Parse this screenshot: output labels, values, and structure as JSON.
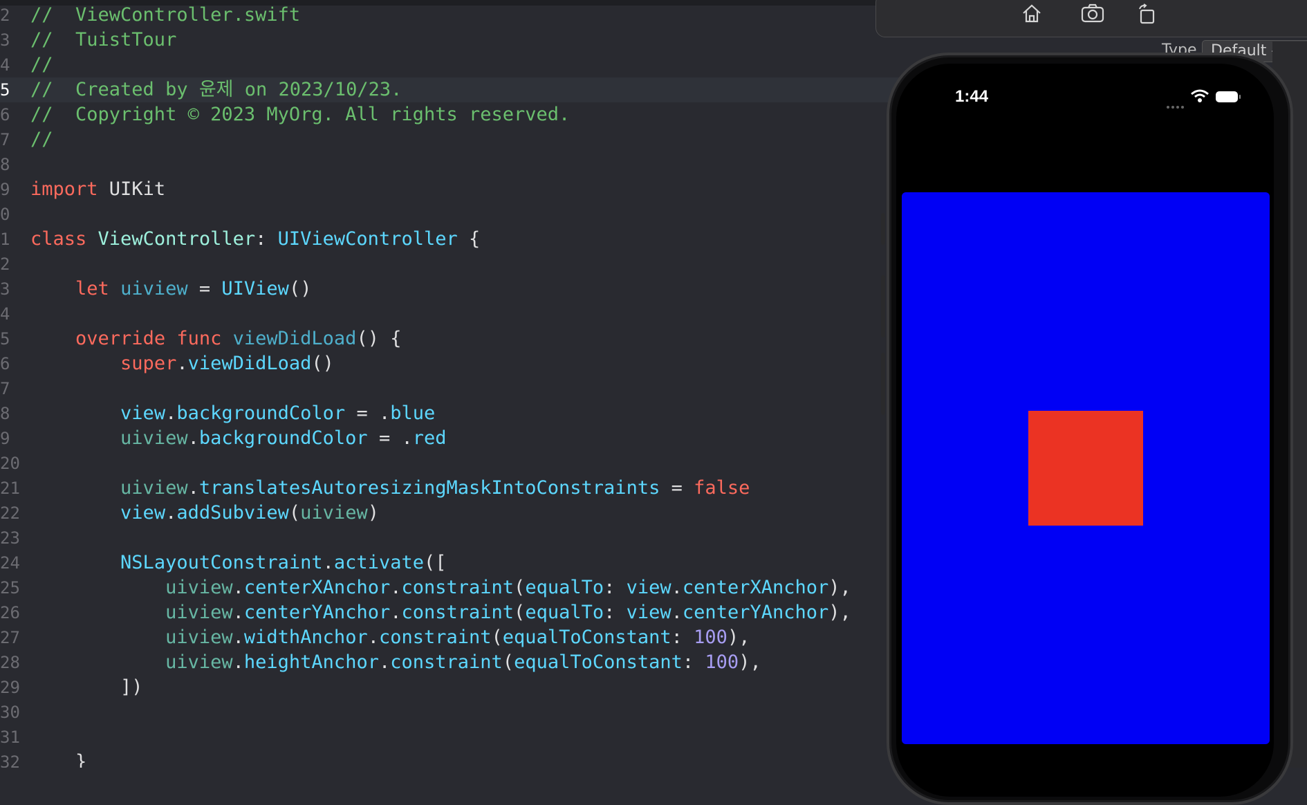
{
  "editor": {
    "current_line": "5",
    "lines": [
      {
        "n": "2",
        "tokens": [
          {
            "c": "cm",
            "t": "//  ViewController.swift"
          }
        ]
      },
      {
        "n": "3",
        "tokens": [
          {
            "c": "cm",
            "t": "//  TuistTour"
          }
        ]
      },
      {
        "n": "4",
        "tokens": [
          {
            "c": "cm",
            "t": "//"
          }
        ]
      },
      {
        "n": "5",
        "tokens": [
          {
            "c": "cm",
            "t": "//  Created by 윤제 on 2023/10/23."
          }
        ]
      },
      {
        "n": "6",
        "tokens": [
          {
            "c": "cm",
            "t": "//  Copyright © 2023 MyOrg. All rights reserved."
          }
        ]
      },
      {
        "n": "7",
        "tokens": [
          {
            "c": "cm",
            "t": "//"
          }
        ]
      },
      {
        "n": "8",
        "tokens": []
      },
      {
        "n": "9",
        "tokens": [
          {
            "c": "kw",
            "t": "import"
          },
          {
            "c": "pl",
            "t": " UIKit"
          }
        ]
      },
      {
        "n": "0",
        "tokens": []
      },
      {
        "n": "1",
        "tokens": [
          {
            "c": "kw",
            "t": "class"
          },
          {
            "c": "pl",
            "t": " "
          },
          {
            "c": "ty",
            "t": "ViewController"
          },
          {
            "c": "pl",
            "t": ": "
          },
          {
            "c": "tp",
            "t": "UIViewController"
          },
          {
            "c": "pl",
            "t": " {"
          }
        ]
      },
      {
        "n": "2",
        "tokens": []
      },
      {
        "n": "3",
        "tokens": [
          {
            "c": "pl",
            "t": "    "
          },
          {
            "c": "kw",
            "t": "let"
          },
          {
            "c": "pl",
            "t": " "
          },
          {
            "c": "ap",
            "t": "uiview"
          },
          {
            "c": "pl",
            "t": " = "
          },
          {
            "c": "tp",
            "t": "UIView"
          },
          {
            "c": "pl",
            "t": "()"
          }
        ]
      },
      {
        "n": "4",
        "tokens": []
      },
      {
        "n": "5",
        "tokens": [
          {
            "c": "pl",
            "t": "    "
          },
          {
            "c": "kw",
            "t": "override func"
          },
          {
            "c": "pl",
            "t": " "
          },
          {
            "c": "ap",
            "t": "viewDidLoad"
          },
          {
            "c": "pl",
            "t": "() {"
          }
        ]
      },
      {
        "n": "6",
        "tokens": [
          {
            "c": "pl",
            "t": "        "
          },
          {
            "c": "kw",
            "t": "super"
          },
          {
            "c": "pl",
            "t": "."
          },
          {
            "c": "tp",
            "t": "viewDidLoad"
          },
          {
            "c": "pl",
            "t": "()"
          }
        ]
      },
      {
        "n": "7",
        "tokens": []
      },
      {
        "n": "8",
        "tokens": [
          {
            "c": "pl",
            "t": "        "
          },
          {
            "c": "tp",
            "t": "view"
          },
          {
            "c": "pl",
            "t": "."
          },
          {
            "c": "tp",
            "t": "backgroundColor"
          },
          {
            "c": "pl",
            "t": " = ."
          },
          {
            "c": "tp",
            "t": "blue"
          }
        ]
      },
      {
        "n": "9",
        "tokens": [
          {
            "c": "pl",
            "t": "        "
          },
          {
            "c": "lc",
            "t": "uiview"
          },
          {
            "c": "pl",
            "t": "."
          },
          {
            "c": "tp",
            "t": "backgroundColor"
          },
          {
            "c": "pl",
            "t": " = ."
          },
          {
            "c": "tp",
            "t": "red"
          }
        ]
      },
      {
        "n": "20",
        "tokens": []
      },
      {
        "n": "21",
        "tokens": [
          {
            "c": "pl",
            "t": "        "
          },
          {
            "c": "lc",
            "t": "uiview"
          },
          {
            "c": "pl",
            "t": "."
          },
          {
            "c": "tp",
            "t": "translatesAutoresizingMaskIntoConstraints"
          },
          {
            "c": "pl",
            "t": " = "
          },
          {
            "c": "kw",
            "t": "false"
          }
        ]
      },
      {
        "n": "22",
        "tokens": [
          {
            "c": "pl",
            "t": "        "
          },
          {
            "c": "tp",
            "t": "view"
          },
          {
            "c": "pl",
            "t": "."
          },
          {
            "c": "tp",
            "t": "addSubview"
          },
          {
            "c": "pl",
            "t": "("
          },
          {
            "c": "lc",
            "t": "uiview"
          },
          {
            "c": "pl",
            "t": ")"
          }
        ]
      },
      {
        "n": "23",
        "tokens": []
      },
      {
        "n": "24",
        "tokens": [
          {
            "c": "pl",
            "t": "        "
          },
          {
            "c": "tp",
            "t": "NSLayoutConstraint"
          },
          {
            "c": "pl",
            "t": "."
          },
          {
            "c": "tp",
            "t": "activate"
          },
          {
            "c": "pl",
            "t": "(["
          }
        ]
      },
      {
        "n": "25",
        "tokens": [
          {
            "c": "pl",
            "t": "            "
          },
          {
            "c": "lc",
            "t": "uiview"
          },
          {
            "c": "pl",
            "t": "."
          },
          {
            "c": "tp",
            "t": "centerXAnchor"
          },
          {
            "c": "pl",
            "t": "."
          },
          {
            "c": "tp",
            "t": "constraint"
          },
          {
            "c": "pl",
            "t": "("
          },
          {
            "c": "tp",
            "t": "equalTo"
          },
          {
            "c": "pl",
            "t": ": "
          },
          {
            "c": "tp",
            "t": "view"
          },
          {
            "c": "pl",
            "t": "."
          },
          {
            "c": "tp",
            "t": "centerXAnchor"
          },
          {
            "c": "pl",
            "t": "),"
          }
        ]
      },
      {
        "n": "26",
        "tokens": [
          {
            "c": "pl",
            "t": "            "
          },
          {
            "c": "lc",
            "t": "uiview"
          },
          {
            "c": "pl",
            "t": "."
          },
          {
            "c": "tp",
            "t": "centerYAnchor"
          },
          {
            "c": "pl",
            "t": "."
          },
          {
            "c": "tp",
            "t": "constraint"
          },
          {
            "c": "pl",
            "t": "("
          },
          {
            "c": "tp",
            "t": "equalTo"
          },
          {
            "c": "pl",
            "t": ": "
          },
          {
            "c": "tp",
            "t": "view"
          },
          {
            "c": "pl",
            "t": "."
          },
          {
            "c": "tp",
            "t": "centerYAnchor"
          },
          {
            "c": "pl",
            "t": "),"
          }
        ]
      },
      {
        "n": "27",
        "tokens": [
          {
            "c": "pl",
            "t": "            "
          },
          {
            "c": "lc",
            "t": "uiview"
          },
          {
            "c": "pl",
            "t": "."
          },
          {
            "c": "tp",
            "t": "widthAnchor"
          },
          {
            "c": "pl",
            "t": "."
          },
          {
            "c": "tp",
            "t": "constraint"
          },
          {
            "c": "pl",
            "t": "("
          },
          {
            "c": "tp",
            "t": "equalToConstant"
          },
          {
            "c": "pl",
            "t": ": "
          },
          {
            "c": "nu",
            "t": "100"
          },
          {
            "c": "pl",
            "t": "),"
          }
        ]
      },
      {
        "n": "28",
        "tokens": [
          {
            "c": "pl",
            "t": "            "
          },
          {
            "c": "lc",
            "t": "uiview"
          },
          {
            "c": "pl",
            "t": "."
          },
          {
            "c": "tp",
            "t": "heightAnchor"
          },
          {
            "c": "pl",
            "t": "."
          },
          {
            "c": "tp",
            "t": "constraint"
          },
          {
            "c": "pl",
            "t": "("
          },
          {
            "c": "tp",
            "t": "equalToConstant"
          },
          {
            "c": "pl",
            "t": ": "
          },
          {
            "c": "nu",
            "t": "100"
          },
          {
            "c": "pl",
            "t": "),"
          }
        ]
      },
      {
        "n": "29",
        "tokens": [
          {
            "c": "pl",
            "t": "        ])"
          }
        ]
      },
      {
        "n": "30",
        "tokens": []
      },
      {
        "n": "31",
        "tokens": []
      },
      {
        "n": "32",
        "tokens": [
          {
            "c": "pl",
            "t": "    }"
          }
        ]
      }
    ]
  },
  "simulator": {
    "status_time": "1:44",
    "toolbar": {
      "home_icon": "home-icon",
      "screenshot_icon": "camera-icon",
      "rotate_icon": "rotate-icon"
    },
    "background_color": "#0000f5",
    "subview_color": "#eb3323"
  },
  "inspector": {
    "type_label": "Type",
    "type_value": "Default - Swift"
  }
}
